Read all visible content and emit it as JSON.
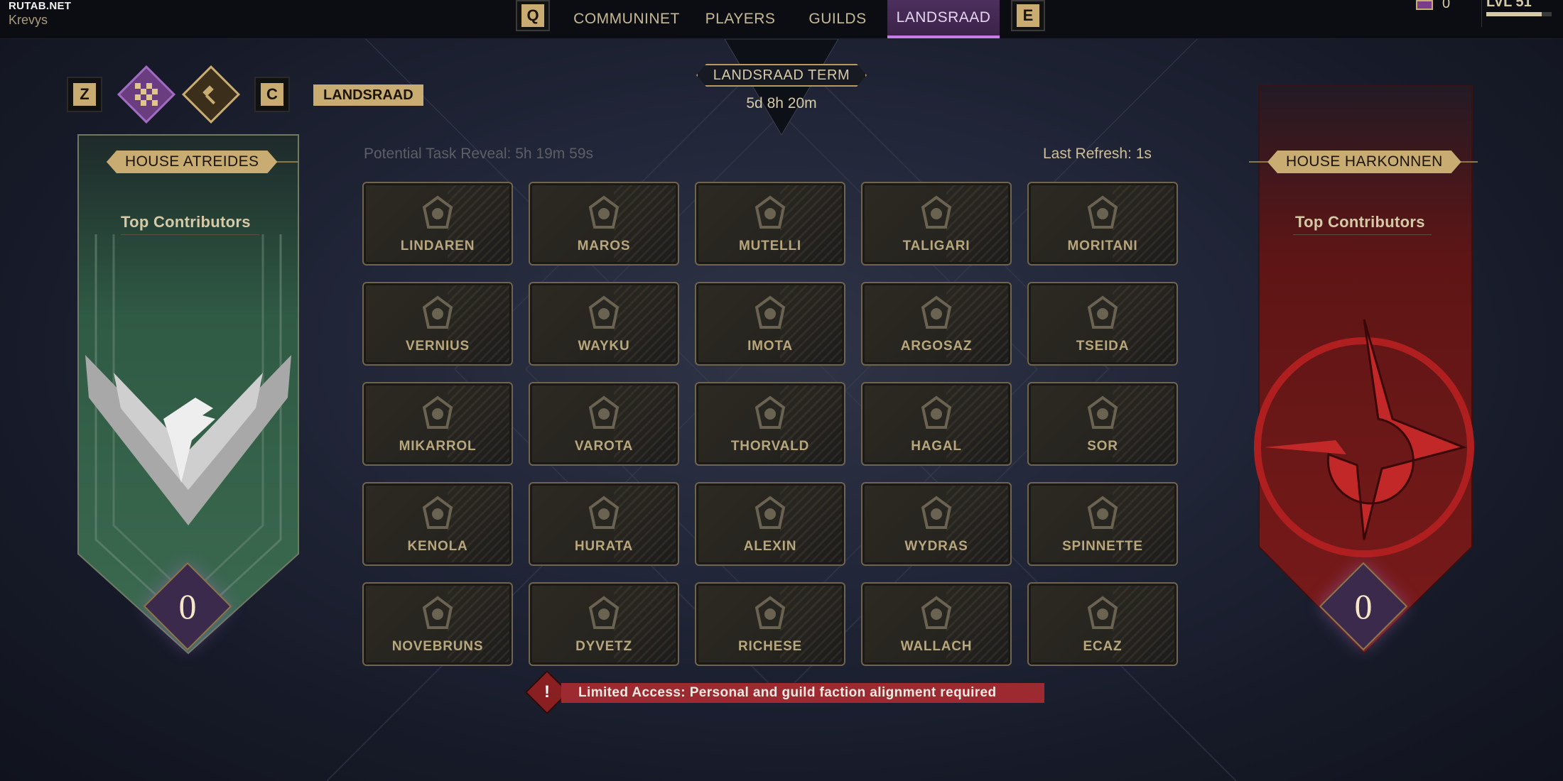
{
  "topbar": {
    "brand": "RUTAB.NET",
    "user": "Krevys",
    "key_left": "Q",
    "key_right": "E",
    "tabs": [
      {
        "label": "COMMUNINET",
        "active": false
      },
      {
        "label": "PLAYERS",
        "active": false
      },
      {
        "label": "GUILDS",
        "active": false
      },
      {
        "label": "LANDSRAAD",
        "active": true
      }
    ],
    "currency_count": "0",
    "level_text": "LVL 51",
    "level_progress": 0.85
  },
  "subnav": {
    "key_left": "Z",
    "key_right": "C",
    "label": "LANDSRAAD"
  },
  "term": {
    "label": "LANDSRAAD TERM",
    "time": "5d 8h 20m"
  },
  "info": {
    "reveal": "Potential Task Reveal: 5h 19m 59s",
    "refresh": "Last Refresh: 1s"
  },
  "houses": [
    {
      "name": "LINDAREN",
      "icon": "lindaren-icon"
    },
    {
      "name": "MAROS",
      "icon": "maros-icon"
    },
    {
      "name": "MUTELLI",
      "icon": "mutelli-icon"
    },
    {
      "name": "TALIGARI",
      "icon": "taligari-icon"
    },
    {
      "name": "MORITANI",
      "icon": "moritani-icon"
    },
    {
      "name": "VERNIUS",
      "icon": "vernius-icon"
    },
    {
      "name": "WAYKU",
      "icon": "wayku-icon"
    },
    {
      "name": "IMOTA",
      "icon": "imota-icon"
    },
    {
      "name": "ARGOSAZ",
      "icon": "argosaz-icon"
    },
    {
      "name": "TSEIDA",
      "icon": "tseida-icon"
    },
    {
      "name": "MIKARROL",
      "icon": "mikarrol-icon"
    },
    {
      "name": "VAROTA",
      "icon": "varota-icon"
    },
    {
      "name": "THORVALD",
      "icon": "thorvald-icon"
    },
    {
      "name": "HAGAL",
      "icon": "hagal-icon"
    },
    {
      "name": "SOR",
      "icon": "sor-icon"
    },
    {
      "name": "KENOLA",
      "icon": "kenola-icon"
    },
    {
      "name": "HURATA",
      "icon": "hurata-icon"
    },
    {
      "name": "ALEXIN",
      "icon": "alexin-icon"
    },
    {
      "name": "WYDRAS",
      "icon": "wydras-icon"
    },
    {
      "name": "SPINNETTE",
      "icon": "spinnette-icon"
    },
    {
      "name": "NOVEBRUNS",
      "icon": "novebruns-icon"
    },
    {
      "name": "DYVETZ",
      "icon": "dyvetz-icon"
    },
    {
      "name": "RICHESE",
      "icon": "richese-icon"
    },
    {
      "name": "WALLACH",
      "icon": "wallach-icon"
    },
    {
      "name": "ECAZ",
      "icon": "ecaz-icon"
    }
  ],
  "warning": "Limited Access: Personal and guild faction alignment required",
  "atreides": {
    "title": "HOUSE ATREIDES",
    "contributors": "Top Contributors",
    "score": "0",
    "color": "#3d6b4f"
  },
  "harkonnen": {
    "title": "HOUSE HARKONNEN",
    "contributors": "Top Contributors",
    "score": "0",
    "color": "#8a1c1c"
  }
}
